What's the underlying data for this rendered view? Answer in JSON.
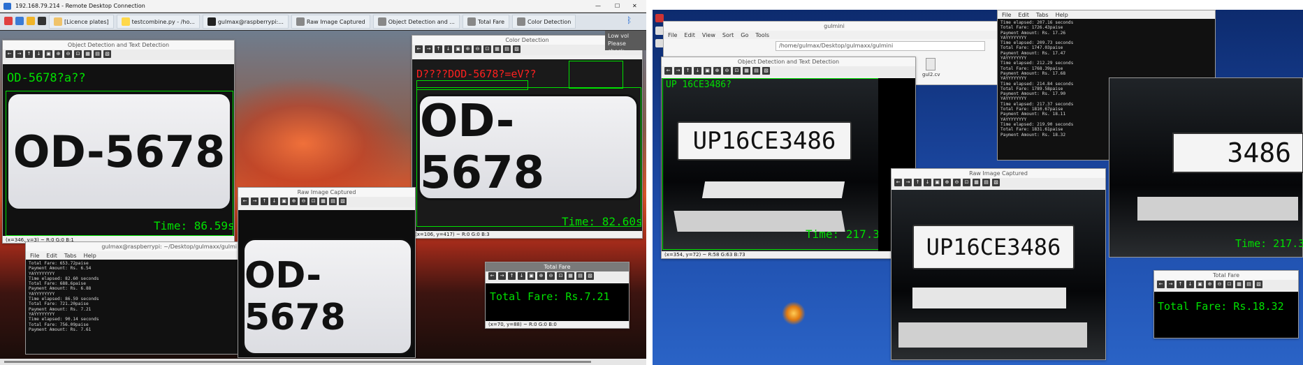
{
  "window": {
    "title": "192.168.79.214 - Remote Desktop Connection",
    "min": "—",
    "max": "☐",
    "close": "✕"
  },
  "taskbar": {
    "apps": [
      {
        "label": "",
        "color": "#e04040"
      },
      {
        "label": "",
        "color": "#3a7bd5"
      },
      {
        "label": "",
        "color": "#f0b429"
      },
      {
        "label": "",
        "color": "#333"
      },
      {
        "label": "[Licence plates]",
        "color": "#f0c36a"
      },
      {
        "label": "testcombine.py - /ho...",
        "color": "#ffd84a"
      },
      {
        "label": "gulmax@raspberrypi:...",
        "color": "#222"
      },
      {
        "label": "Raw Image Captured",
        "color": "#888"
      },
      {
        "label": "Object Detection and ...",
        "color": "#888"
      },
      {
        "label": "Total Fare",
        "color": "#888"
      },
      {
        "label": "Color Detection",
        "color": "#888"
      }
    ]
  },
  "left": {
    "obj_win": {
      "title": "Object Detection and Text Detection",
      "ocr": "OD-5678?a??",
      "plate": "OD-5678",
      "time": "Time: 86.59s",
      "status": "(x=346, y=3) ~ R:0 G:0 B:1"
    },
    "color_win": {
      "title": "Color Detection",
      "ocr": "D????DOD-5678?=eV??",
      "plate": "OD-5678",
      "time": "Time: 82.60s",
      "status": "(x=106, y=417) ~ R:0 G:0 B:3"
    },
    "raw_win": {
      "title": "Raw Image Captured",
      "plate": "OD-5678"
    },
    "fare_win": {
      "title": "Total Fare",
      "text": "Total Fare: Rs.7.21",
      "status": "(x=70, y=88) ~ R:0 G:0 B:0"
    },
    "side_notice": [
      "Low vol",
      "Please check"
    ],
    "term": {
      "title": "gulmax@raspberrypi: ~/Desktop/gulmaxx/gulmi",
      "menu": [
        "File",
        "Edit",
        "Tabs",
        "Help"
      ],
      "lines": [
        "Total Fare: 653.72paise",
        "Payment Amount: Rs. 6.54",
        "YAYYYYYYYY",
        "Time elapsed: 82.60 seconds",
        "Total Fare: 688.6paise",
        "Payment Amount: Rs. 6.88",
        "YAYYYYYYYY",
        "Time elapsed: 86.59 seconds",
        "Total Fare: 721.20paise",
        "Payment Amount: Rs. 7.21",
        "YAYYYYYYYY",
        "Time elapsed: 90.14 seconds",
        "Total Fare: 756.09paise",
        "Payment Amount: Rs. 7.61"
      ]
    }
  },
  "right": {
    "fm": {
      "title": "gulmini",
      "menu": [
        "File",
        "Edit",
        "View",
        "Sort",
        "Go",
        "Tools"
      ],
      "path": "/home/gulmax/Desktop/gulmaxx/gulmini",
      "file": "gul2.cv"
    },
    "obj_win": {
      "title": "Object Detection and Text Detection",
      "ocr": "UP 16CE3486?",
      "plate": "UP16CE3486",
      "time": "Time: 217.37s",
      "status": "(x=354, y=72) ~ R:58 G:63 B:73"
    },
    "raw_win": {
      "title": "Raw Image Captured",
      "plate": "UP16CE3486"
    },
    "back_plate": "3486",
    "back_time": "Time: 217.3",
    "fare_win": {
      "title": "Total Fare",
      "text": "Total Fare: Rs.18.32"
    },
    "term": {
      "menu": [
        "File",
        "Edit",
        "Tabs",
        "Help"
      ],
      "lines": [
        "Time elapsed: 207.16 seconds",
        "Total Fare: 1726.43paise",
        "Payment Amount: Rs. 17.26",
        "YAYYYYYYYY",
        "Time elapsed: 209.73 seconds",
        "Total Fare: 1747.03paise",
        "Payment Amount: Rs. 17.47",
        "YAYYYYYYYY",
        "Time elapsed: 212.29 seconds",
        "Total Fare: 1768.39paise",
        "Payment Amount: Rs. 17.68",
        "YAYYYYYYYY",
        "Time elapsed: 214.84 seconds",
        "Total Fare: 1789.58paise",
        "Payment Amount: Rs. 17.90",
        "YAYYYYYYYY",
        "Time elapsed: 217.37 seconds",
        "Total Fare: 1810.67paise",
        "Payment Amount: Rs. 18.11",
        "YAYYYYYYYY",
        "Time elapsed: 219.90 seconds",
        "Total Fare: 1831.61paise",
        "Payment Amount: Rs. 18.32"
      ]
    }
  },
  "tools": [
    "←",
    "→",
    "↑",
    "↓",
    "▣",
    "⊕",
    "⊖",
    "⊡",
    "▦",
    "▤",
    "▧"
  ]
}
